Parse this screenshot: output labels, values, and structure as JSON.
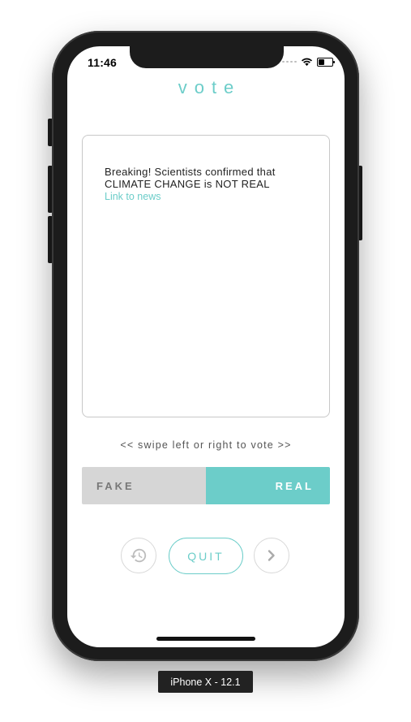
{
  "device": {
    "label": "iPhone X - 12.1"
  },
  "status_bar": {
    "time": "11:46",
    "battery_level": 0.45
  },
  "header": {
    "title": "vote"
  },
  "news_card": {
    "text": "Breaking! Scientists confirmed that CLIMATE CHANGE is NOT REAL",
    "link_label": "Link to news"
  },
  "hint": "<< swipe left or right to vote >>",
  "vote": {
    "fake_label": "FAKE",
    "real_label": "REAL"
  },
  "actions": {
    "history_icon": "history-icon",
    "quit_label": "QUIT",
    "next_icon": "chevron-right-icon"
  },
  "colors": {
    "accent": "#6ccdc9",
    "fake_bg": "#d6d6d6",
    "frame": "#1c1c1c"
  }
}
